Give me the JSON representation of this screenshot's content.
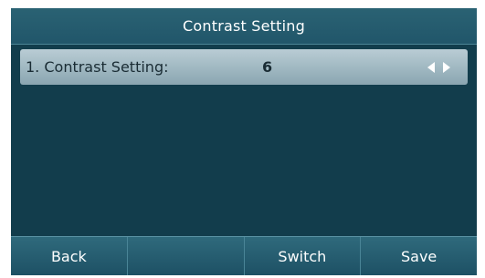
{
  "screen": {
    "title": "Contrast Setting"
  },
  "settings": {
    "items": [
      {
        "label": "1. Contrast Setting:",
        "value": "6"
      }
    ]
  },
  "softkeys": [
    "Back",
    "",
    "Switch",
    "Save"
  ],
  "icons": {
    "left": "arrow-left-icon",
    "right": "arrow-right-icon"
  },
  "colors": {
    "background": "#153e4d",
    "title_bar": "#2a6273",
    "selected_row": "#b9ccd4",
    "text_light": "#ffffff"
  }
}
